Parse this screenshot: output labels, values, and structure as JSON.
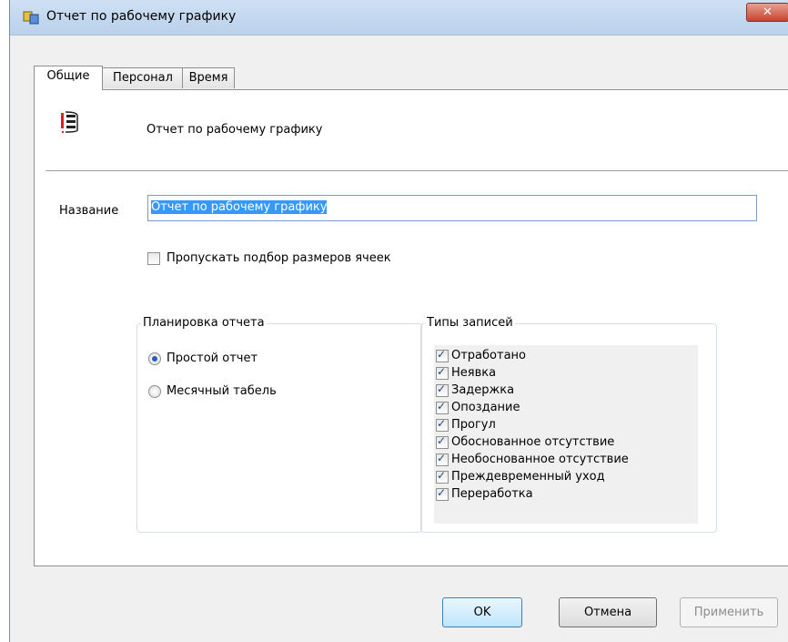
{
  "window": {
    "title": "Отчет по рабочему графику",
    "close_label": "✕"
  },
  "tabs": [
    {
      "label": "Общие",
      "active": true
    },
    {
      "label": "Персонал",
      "active": false
    },
    {
      "label": "Время",
      "active": false
    }
  ],
  "header": {
    "title": "Отчет по рабочему графику",
    "icon": "report-list-icon"
  },
  "name_field": {
    "label": "Название",
    "value": "Отчет по рабочему графику"
  },
  "skip_option": {
    "label": "Пропускать подбор размеров ячеек",
    "checked": false
  },
  "layout_group": {
    "title": "Планировка отчета",
    "options": [
      {
        "label": "Простой отчет",
        "checked": true
      },
      {
        "label": "Месячный табель",
        "checked": false
      }
    ]
  },
  "types_group": {
    "title": "Типы записей",
    "items": [
      {
        "label": "Отработано",
        "checked": true
      },
      {
        "label": "Неявка",
        "checked": true
      },
      {
        "label": "Задержка",
        "checked": true
      },
      {
        "label": "Опоздание",
        "checked": true
      },
      {
        "label": "Прогул",
        "checked": true
      },
      {
        "label": "Обоснованное отсутствие",
        "checked": true
      },
      {
        "label": "Необоснованное отсутствие",
        "checked": true
      },
      {
        "label": "Преждевременный уход",
        "checked": true
      },
      {
        "label": "Переработка",
        "checked": true
      }
    ]
  },
  "buttons": {
    "ok": "OK",
    "cancel": "Отмена",
    "apply": "Применить"
  },
  "colors": {
    "accent": "#3399ff",
    "report_icon": "#e02020"
  }
}
